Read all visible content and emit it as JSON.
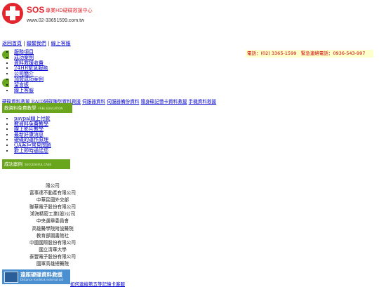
{
  "logo": {
    "brand_sos": "SOS",
    "brand_title": "專業HD硬碟救援中心",
    "brand_url": "www.02-33651599.com.tw"
  },
  "top_nav": [
    "返回首頁",
    "聯繫我們",
    "線上客服"
  ],
  "contact": "電話：(02) 3365-1599　緊急連絡電話：0936-543-997",
  "menu": [
    "服務項目",
    "成功案例",
    "資料救援收費",
    "24HR緊急服務",
    "公司簡介",
    "加盟成功案例",
    "留言板",
    "線上客服"
  ],
  "categories": [
    "硬碟資料救援",
    "RAID磁碟陣列資料救援",
    "伺服器資料",
    "伺服器備份資料",
    "隨身碟記憶卡資料救援",
    "手機資料救援"
  ],
  "edu_banner": {
    "zh": "教資料免費教學",
    "en": "FREE EDUCATION"
  },
  "edu_links": [
    "paypal線上付款",
    "教資料免費教學",
    "線上影片教學",
    "最新好康消息",
    "硬碟的運作原理",
    "QA客戶常見問題",
    "歡上即時通話您"
  ],
  "cases_banner": {
    "zh": "成功案例",
    "en": "SUCCESSFUL CASE"
  },
  "cases": [
    "限公司",
    "富事達不動產有限公司",
    "中華民國外交部",
    "聯華電子股份有限公司",
    "鴻海精密工業(股)公司",
    "中央選舉委員會",
    "高雄醫學院附設醫院",
    "教育部圖書館社",
    "中國國際股份有限公司",
    "國立清華大學",
    "泰豐電子股份有限公司",
    "國軍高雄總醫院"
  ],
  "remote_banner": {
    "zh": "遠距硬碟資料救援",
    "en": "Distance harddisk external aid"
  },
  "footer_link": "如何連線第五等記憶卡客服",
  "colors": {
    "green": "#6aa51e",
    "red": "#cc0000",
    "blue": "#4a8fd0"
  }
}
